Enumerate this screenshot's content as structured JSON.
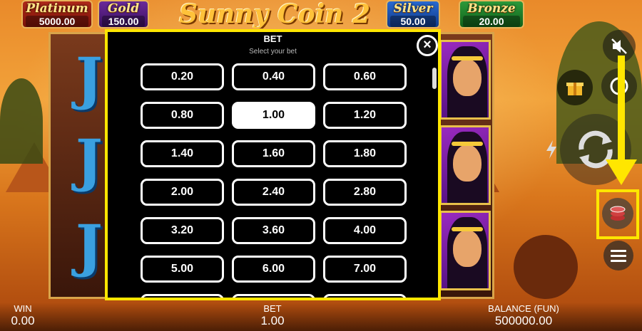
{
  "jackpots": {
    "platinum": {
      "name": "Platinum",
      "value": "5000.00"
    },
    "gold": {
      "name": "Gold",
      "value": "150.00"
    },
    "silver": {
      "name": "Silver",
      "value": "50.00"
    },
    "bronze": {
      "name": "Bronze",
      "value": "20.00"
    }
  },
  "logo": "Sunny Coin 2",
  "bet_modal": {
    "title": "BET",
    "subtitle": "Select your bet",
    "selected": "1.00",
    "options": [
      "0.20",
      "0.40",
      "0.60",
      "0.80",
      "1.00",
      "1.20",
      "1.40",
      "1.60",
      "1.80",
      "2.00",
      "2.40",
      "2.80",
      "3.20",
      "3.60",
      "4.00",
      "5.00",
      "6.00",
      "7.00"
    ]
  },
  "footer": {
    "win_label": "WIN",
    "win_value": "0.00",
    "bet_label": "BET",
    "bet_value": "1.00",
    "balance_label": "BALANCE (FUN)",
    "balance_value": "500000.00"
  },
  "colors": {
    "highlight": "#ffe600",
    "accent": "#ffc23a"
  },
  "icons": [
    "close-icon",
    "sound-muted-icon",
    "gift-icon",
    "autoplay-icon",
    "spin-icon",
    "lightning-icon",
    "coin-stack-icon",
    "menu-icon"
  ]
}
